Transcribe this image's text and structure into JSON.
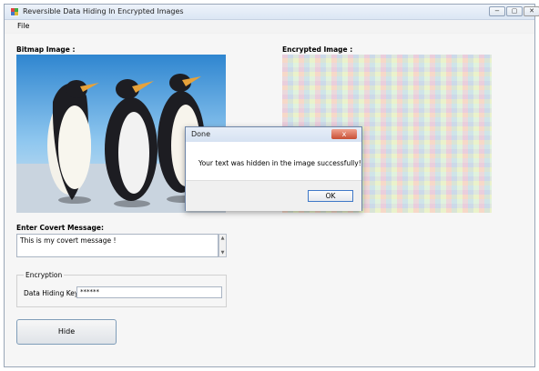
{
  "window": {
    "title": "Reversible Data Hiding In Encrypted Images",
    "controls": {
      "minimize": "−",
      "maximize": "▢",
      "close": "✕"
    }
  },
  "menu": {
    "file": "File"
  },
  "main": {
    "bitmap_label": "Bitmap Image :",
    "encrypted_label": "Encrypted Image :",
    "covert_label": "Enter Covert Message:",
    "covert_value": "This is my covert message !",
    "scroll_up": "▲",
    "scroll_down": "▼",
    "encryption_group": "Encryption",
    "key_label": "Data Hiding Key :",
    "key_value": "******",
    "hide_button": "Hide"
  },
  "dialog": {
    "title": "Done",
    "message": "Your text was hidden in the image successfully!",
    "ok": "OK",
    "close": "x"
  },
  "colors": {
    "window_border": "#9aa7b8",
    "dialog_close": "#c84f35",
    "button_border": "#7f9db9"
  },
  "icons": {
    "app": "app-icon",
    "close": "close-icon"
  }
}
